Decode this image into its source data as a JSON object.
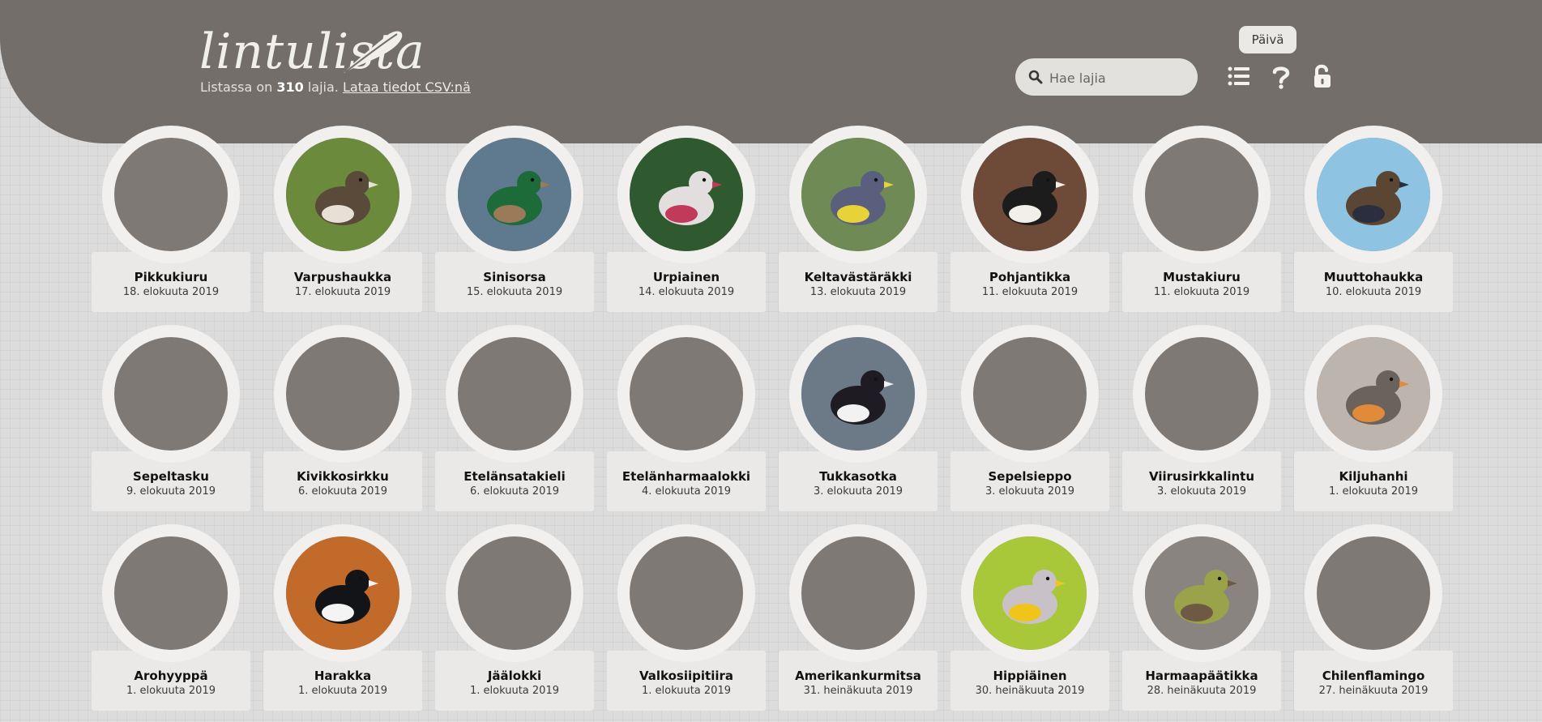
{
  "app": {
    "logo_text": "lintulista",
    "subtitle_prefix": "Listassa on ",
    "species_count": "310",
    "subtitle_suffix": " lajia. ",
    "download_link": "Lataa tiedot CSV:nä"
  },
  "search": {
    "placeholder": "Hae lajia",
    "value": ""
  },
  "toolbar": {
    "day_button": "Päivä",
    "icons": [
      "list-icon",
      "help-icon",
      "unlock-icon"
    ]
  },
  "colors": {
    "header": "#736e69",
    "background": "#dcdcdc",
    "card": "#eae9e8",
    "photo_placeholder": "#7f7976"
  },
  "birds": [
    {
      "name": "Pikkukiuru",
      "date": "18. elokuuta 2019",
      "has_photo": false
    },
    {
      "name": "Varpushaukka",
      "date": "17. elokuuta 2019",
      "has_photo": true,
      "colors": [
        "#6c8a3c",
        "#5a4a3a",
        "#e6e0d6"
      ]
    },
    {
      "name": "Sinisorsa",
      "date": "15. elokuuta 2019",
      "has_photo": true,
      "colors": [
        "#5f7a8e",
        "#1e6b3a",
        "#9a7a58"
      ]
    },
    {
      "name": "Urpiainen",
      "date": "14. elokuuta 2019",
      "has_photo": true,
      "colors": [
        "#2f5a30",
        "#e2dedd",
        "#c23a5a"
      ]
    },
    {
      "name": "Keltavästäräkki",
      "date": "13. elokuuta 2019",
      "has_photo": true,
      "colors": [
        "#6f8a55",
        "#5a5f7e",
        "#e8d23a"
      ]
    },
    {
      "name": "Pohjantikka",
      "date": "11. elokuuta 2019",
      "has_photo": true,
      "colors": [
        "#6e4a38",
        "#1c1c1c",
        "#f2efe8"
      ]
    },
    {
      "name": "Mustakiuru",
      "date": "11. elokuuta 2019",
      "has_photo": false
    },
    {
      "name": "Muuttohaukka",
      "date": "10. elokuuta 2019",
      "has_photo": true,
      "colors": [
        "#8ec3e2",
        "#5a4632",
        "#2a2e3e"
      ]
    },
    {
      "name": "Sepeltasku",
      "date": "9. elokuuta 2019",
      "has_photo": false
    },
    {
      "name": "Kivikkosirkku",
      "date": "6. elokuuta 2019",
      "has_photo": false
    },
    {
      "name": "Etelänsatakieli",
      "date": "6. elokuuta 2019",
      "has_photo": false
    },
    {
      "name": "Etelänharmaalokki",
      "date": "4. elokuuta 2019",
      "has_photo": false
    },
    {
      "name": "Tukkasotka",
      "date": "3. elokuuta 2019",
      "has_photo": true,
      "colors": [
        "#6c7a88",
        "#1e1c22",
        "#f2f2f2"
      ]
    },
    {
      "name": "Sepelsieppo",
      "date": "3. elokuuta 2019",
      "has_photo": false
    },
    {
      "name": "Viirusirkkalintu",
      "date": "3. elokuuta 2019",
      "has_photo": false
    },
    {
      "name": "Kiljuhanhi",
      "date": "1. elokuuta 2019",
      "has_photo": true,
      "colors": [
        "#bdb5ad",
        "#6a635c",
        "#e08a3a"
      ]
    },
    {
      "name": "Arohyyppä",
      "date": "1. elokuuta 2019",
      "has_photo": false
    },
    {
      "name": "Harakka",
      "date": "1. elokuuta 2019",
      "has_photo": true,
      "colors": [
        "#c26a2a",
        "#121418",
        "#f4f4f4"
      ]
    },
    {
      "name": "Jäälokki",
      "date": "1. elokuuta 2019",
      "has_photo": false
    },
    {
      "name": "Valkosiipitiira",
      "date": "1. elokuuta 2019",
      "has_photo": false
    },
    {
      "name": "Amerikankurmitsa",
      "date": "31. heinäkuuta 2019",
      "has_photo": false
    },
    {
      "name": "Hippiäinen",
      "date": "30. heinäkuuta 2019",
      "has_photo": true,
      "colors": [
        "#a8c83a",
        "#c8c2c8",
        "#f0c418"
      ]
    },
    {
      "name": "Harmaapäätikka",
      "date": "28. heinäkuuta 2019",
      "has_photo": true,
      "colors": [
        "#8a8480",
        "#9aa24a",
        "#6e5a44"
      ]
    },
    {
      "name": "Chilenflamingo",
      "date": "27. heinäkuuta 2019",
      "has_photo": false
    }
  ]
}
